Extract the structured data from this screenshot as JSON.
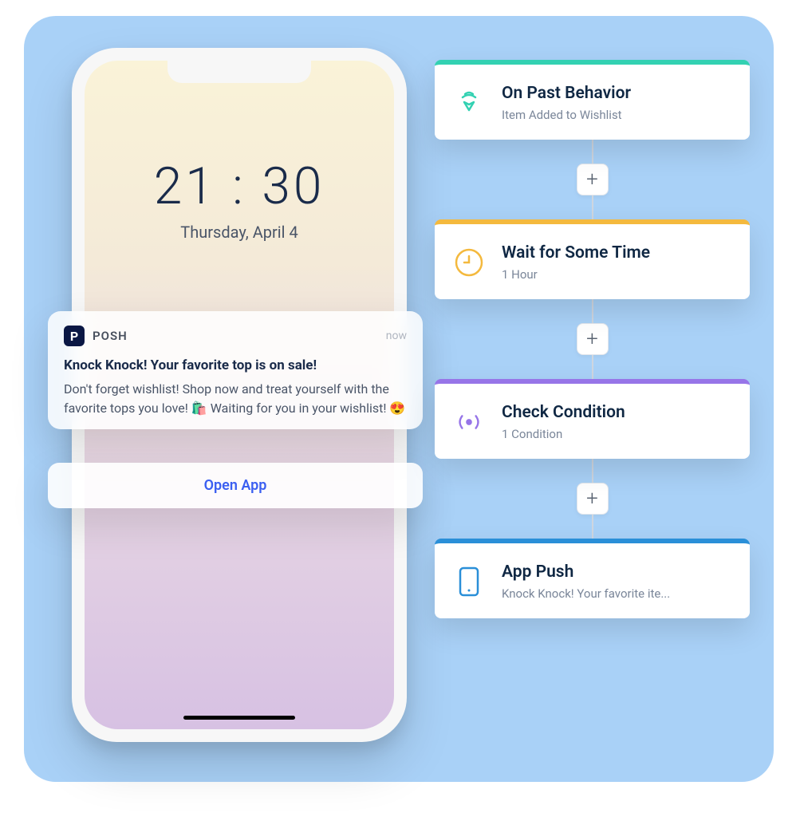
{
  "phone": {
    "time": "21 : 30",
    "date": "Thursday, April 4"
  },
  "notification": {
    "app_letter": "P",
    "app_name": "POSH",
    "timestamp": "now",
    "title": "Knock Knock! Your favorite top is on sale!",
    "body": "Don't forget wishlist! Shop now and treat yourself with the favorite tops you love! 🛍️ Waiting for you in your wishlist! 😍",
    "action": "Open App"
  },
  "flow": {
    "nodes": [
      {
        "title": "On Past Behavior",
        "subtitle": "Item Added to Wishlist",
        "accent": "#33d1b2",
        "icon": "beacon"
      },
      {
        "title": "Wait for Some Time",
        "subtitle": "1 Hour",
        "accent": "#f4b93e",
        "icon": "clock"
      },
      {
        "title": "Check Condition",
        "subtitle": "1 Condition",
        "accent": "#9775e8",
        "icon": "signal"
      },
      {
        "title": "App Push",
        "subtitle": "Knock Knock! Your favorite ite...",
        "accent": "#2a8fd8",
        "icon": "phone"
      }
    ],
    "plus_label": "+"
  }
}
